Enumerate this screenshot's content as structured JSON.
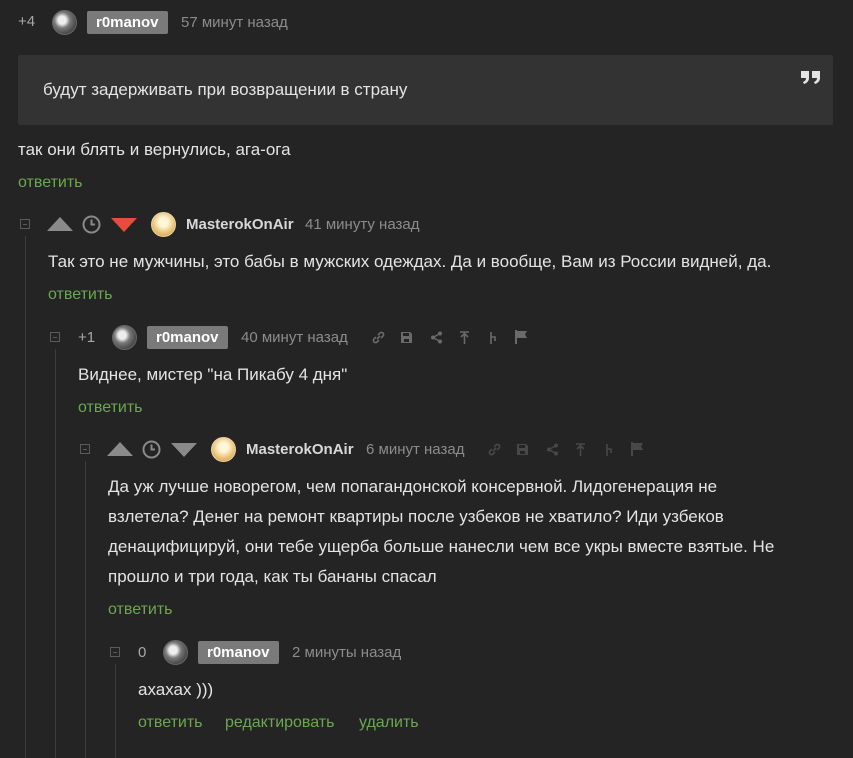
{
  "comments": [
    {
      "rating": "+4",
      "user": "r0manov",
      "time": "57 минут назад",
      "quote": "будут задерживать при возвращении в страну",
      "quote_icon": "quote-icon",
      "text": "так они блять и вернулись, ага-ога",
      "reply": "ответить"
    },
    {
      "user": "MasterokOnAir",
      "time": "41 минуту назад",
      "text": "Так это не мужчины, это бабы в мужских одеждах. Да и вообще, Вам из России видней, да.",
      "reply": "ответить",
      "downvote_color": "#e74c3c"
    },
    {
      "rating": "+1",
      "user": "r0manov",
      "time": "40 минут назад",
      "text": "Виднее, мистер \"на Пикабу 4 дня\"",
      "reply": "ответить"
    },
    {
      "user": "MasterokOnAir",
      "time": "6 минут назад",
      "text_lines": [
        "Да уж лучше новорегом, чем попагандонской консервной. Лидогенерация не",
        "взлетела? Денег на ремонт квартиры после узбеков не хватило? Иди узбеков",
        "денацифицируй, они тебе ущерба больше нанесли чем все укры вместе взятые. Не",
        "прошло и три года, как ты бананы спасал"
      ],
      "reply": "ответить"
    },
    {
      "rating": "0",
      "user": "r0manov",
      "time": "2 минуты назад",
      "text": "ахахах )))",
      "reply": "ответить",
      "edit": "редактировать",
      "delete": "удалить"
    }
  ],
  "colors": {
    "background": "#242424",
    "link_green": "#6aa84f",
    "badge": "#7a7a7a"
  }
}
